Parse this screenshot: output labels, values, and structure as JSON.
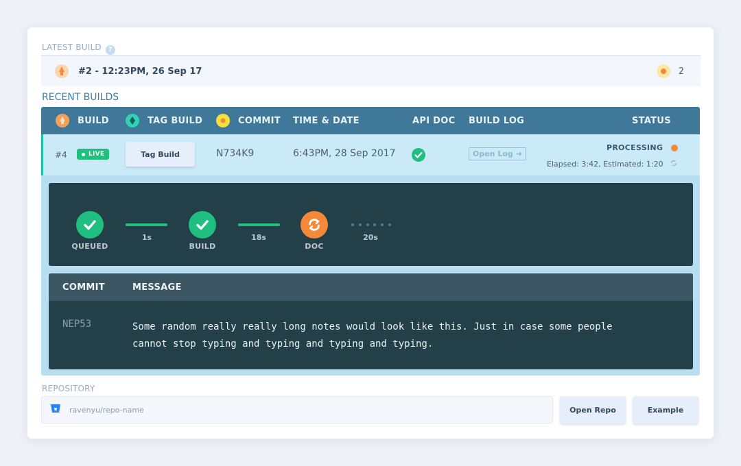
{
  "latest_build": {
    "section_label": "LATEST BUILD",
    "help_glyph": "?",
    "title": "#2 - 12:23PM, 26 Sep 17",
    "count": "2"
  },
  "recent_builds": {
    "section_label": "RECENT BUILDS",
    "headers": {
      "build": "BUILD",
      "tag_build": "TAG BUILD",
      "commit": "COMMIT",
      "time_date": "TIME & DATE",
      "api_doc": "API DOC",
      "build_log": "BUILD LOG",
      "status": "STATUS"
    },
    "row": {
      "build_number": "#4",
      "live_label": "LIVE",
      "tag_build_button": "Tag Build",
      "commit": "N734K9",
      "time_date": "6:43PM, 28 Sep 2017",
      "open_log_label": "Open Log",
      "status": "PROCESSING",
      "elapsed_text": "Elapsed: 3:42, Estimated: 1:20"
    },
    "pipeline": {
      "steps": [
        {
          "label": "QUEUED",
          "state": "done"
        },
        {
          "label": "BUILD",
          "state": "done"
        },
        {
          "label": "DOC",
          "state": "in-progress"
        }
      ],
      "durations": [
        "1s",
        "18s",
        "20s"
      ]
    },
    "commit_panel": {
      "headers": {
        "commit": "COMMIT",
        "message": "MESSAGE"
      },
      "commit": "NEP53",
      "message_line1": "Some random really really long notes would look like this. Just in case some people",
      "message_line2": "cannot stop typing and typing and typing and typing."
    }
  },
  "repository": {
    "section_label": "REPOSITORY",
    "placeholder": "ravenyu/repo-name",
    "open_repo_button": "Open Repo",
    "example_button": "Example"
  },
  "colors": {
    "header_bg": "#3f7898",
    "row_bg": "#cbeaf7",
    "panel_bg": "#233f48",
    "success": "#1fbf7f",
    "processing": "#f5893a",
    "accent_teal": "#1cc3a1"
  },
  "icons": {
    "latest_build": "rocket-icon",
    "count": "sun-icon",
    "build": "rocket-icon",
    "tag_build": "tag-icon",
    "commit": "commit-icon",
    "api_doc": "check-circle-icon",
    "build_log": "arrow-right-icon",
    "status_dot": "status-dot-icon",
    "status_refresh": "refresh-icon",
    "repo": "bitbucket-icon"
  }
}
